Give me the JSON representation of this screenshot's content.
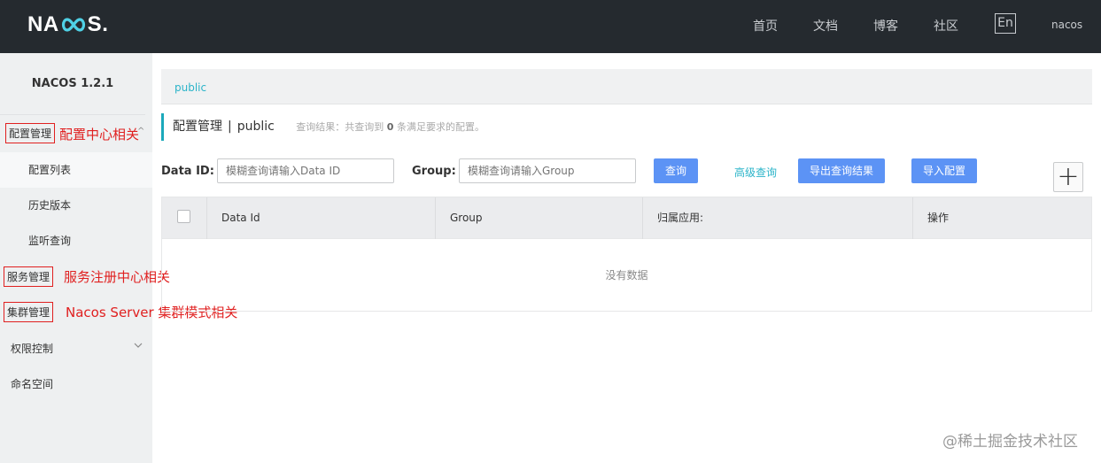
{
  "header": {
    "logo_text_left": "NA",
    "logo_text_right": "S",
    "nav": [
      "首页",
      "文档",
      "博客",
      "社区"
    ],
    "lang_button": "En",
    "user": "nacos"
  },
  "sidebar": {
    "version": "NACOS 1.2.1",
    "items": {
      "config_mgmt": "配置管理",
      "config_list": "配置列表",
      "history": "历史版本",
      "listener": "监听查询",
      "service_mgmt": "服务管理",
      "cluster_mgmt": "集群管理",
      "permission": "权限控制",
      "namespace": "命名空间"
    }
  },
  "annotations": {
    "config": "配置中心相关",
    "service": "服务注册中心相关",
    "cluster": "Nacos Server 集群模式相关"
  },
  "breadcrumb": "public",
  "title": {
    "label": "配置管理",
    "separator": "|",
    "namespace": "public",
    "summary_prefix": "查询结果：共查询到",
    "summary_count": "0",
    "summary_suffix": "条满足要求的配置。"
  },
  "search": {
    "data_id_label": "Data ID:",
    "data_id_placeholder": "模糊查询请输入Data ID",
    "group_label": "Group:",
    "group_placeholder": "模糊查询请输入Group",
    "query_button": "查询",
    "advanced_link": "高级查询",
    "export_button": "导出查询结果",
    "import_button": "导入配置",
    "add_button": "+"
  },
  "table": {
    "columns": [
      "Data Id",
      "Group",
      "归属应用:",
      "操作"
    ],
    "empty_text": "没有数据"
  },
  "watermark": "@稀土掘金技术社区",
  "colors": {
    "topbar": "#252a2f",
    "primary_button": "#5c93f5",
    "link": "#2bb4c9",
    "annotation": "#e02020"
  }
}
